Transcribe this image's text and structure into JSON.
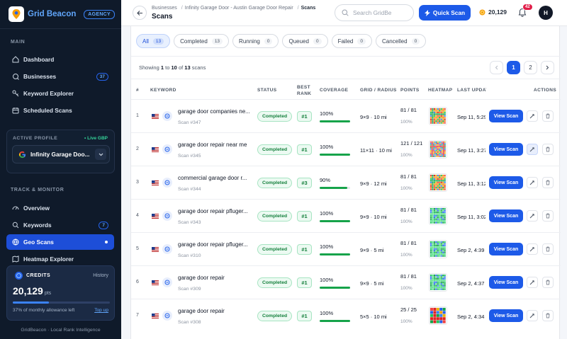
{
  "brand": {
    "name": "Grid Beacon",
    "badge": "AGENCY"
  },
  "sidebar": {
    "main_label": "MAIN",
    "main_items": [
      {
        "label": "Dashboard",
        "icon": "dashboard-icon"
      },
      {
        "label": "Businesses",
        "icon": "building-icon",
        "count": "37"
      },
      {
        "label": "Keyword Explorer",
        "icon": "key-icon"
      },
      {
        "label": "Scheduled Scans",
        "icon": "calendar-icon"
      }
    ],
    "profile": {
      "label": "ACTIVE PROFILE",
      "live": "• Live GBP",
      "name": "Infinity Garage Doo..."
    },
    "track_label": "TRACK & MONITOR",
    "track_items": [
      {
        "label": "Overview",
        "icon": "gauge-icon"
      },
      {
        "label": "Keywords",
        "icon": "search-icon",
        "count": "7"
      },
      {
        "label": "Geo Scans",
        "icon": "globe-icon",
        "active": true
      },
      {
        "label": "Heatmap Explorer",
        "icon": "map-icon"
      }
    ],
    "credits": {
      "title": "CREDITS",
      "history": "History",
      "amount": "20,129",
      "unit": "pts",
      "allowance": "37% of monthly allowance left",
      "topup": "Top up",
      "fraction": 0.37
    },
    "footer": "GridBeacon · Local Rank Intelligence"
  },
  "topbar": {
    "breadcrumbs": [
      "Businesses",
      "Infinity Garage Door - Austin Garage Door Repair",
      "Scans"
    ],
    "title": "Scans",
    "search_placeholder": "Search GridBe",
    "quick_scan": "Quick Scan",
    "credits": "20,129",
    "notifications": "42",
    "avatar": "H"
  },
  "filters": [
    {
      "label": "All",
      "count": "13",
      "active": true
    },
    {
      "label": "Completed",
      "count": "13"
    },
    {
      "label": "Running",
      "count": "0"
    },
    {
      "label": "Queued",
      "count": "0"
    },
    {
      "label": "Failed",
      "count": "0"
    },
    {
      "label": "Cancelled",
      "count": "0"
    }
  ],
  "showing": {
    "prefix": "Showing",
    "from": "1",
    "to_word": "to",
    "to": "10",
    "of_word": "of",
    "total": "13",
    "suffix": "scans"
  },
  "pagination": {
    "pages": [
      "1",
      "2"
    ]
  },
  "columns": {
    "num": "#",
    "keyword": "KEYWORD",
    "status": "STATUS",
    "best_rank": "BEST\nRANK",
    "coverage": "COVERAGE",
    "grid": "GRID / RADIUS",
    "points": "POINTS",
    "heatmap": "HEATMAP",
    "last_updated": "LAST UPDATED",
    "actions": "ACTIONS"
  },
  "rows": [
    {
      "n": "1",
      "keyword": "garage door companies ne...",
      "scan": "Scan #347",
      "status": "Completed",
      "rank": "#1",
      "coverage": "100%",
      "cov": 1.0,
      "grid": "9×9 · 10 mi",
      "points": "81 / 81",
      "pct": "100%",
      "date": "Sep 11, 5:29",
      "heat": "r",
      "view": "View Scan"
    },
    {
      "n": "2",
      "keyword": "garage door repair near me",
      "scan": "Scan #345",
      "status": "Completed",
      "rank": "#1",
      "coverage": "100%",
      "cov": 1.0,
      "grid": "11×11 · 10 mi",
      "points": "121 / 121",
      "pct": "100%",
      "date": "Sep 11, 3:27",
      "heat": "m",
      "view": "View Scan"
    },
    {
      "n": "3",
      "keyword": "commercial garage door r...",
      "scan": "Scan #344",
      "status": "Completed",
      "rank": "#3",
      "coverage": "90%",
      "cov": 0.9,
      "grid": "9×9 · 12 mi",
      "points": "81 / 81",
      "pct": "100%",
      "date": "Sep 11, 3:12",
      "heat": "r",
      "view": "View Scan"
    },
    {
      "n": "4",
      "keyword": "garage door repair pfluger...",
      "scan": "Scan #343",
      "status": "Completed",
      "rank": "#1",
      "coverage": "100%",
      "cov": 1.0,
      "grid": "9×9 · 10 mi",
      "points": "81 / 81",
      "pct": "100%",
      "date": "Sep 11, 3:02",
      "heat": "g",
      "view": "View Scan"
    },
    {
      "n": "5",
      "keyword": "garage door repair pfluger...",
      "scan": "Scan #310",
      "status": "Completed",
      "rank": "#1",
      "coverage": "100%",
      "cov": 1.0,
      "grid": "9×9 · 5 mi",
      "points": "81 / 81",
      "pct": "100%",
      "date": "Sep 2, 4:39",
      "heat": "g",
      "view": "View Scan"
    },
    {
      "n": "6",
      "keyword": "garage door repair",
      "scan": "Scan #309",
      "status": "Completed",
      "rank": "#1",
      "coverage": "100%",
      "cov": 1.0,
      "grid": "9×9 · 5 mi",
      "points": "81 / 81",
      "pct": "100%",
      "date": "Sep 2, 4:37",
      "heat": "g",
      "view": "View Scan"
    },
    {
      "n": "7",
      "keyword": "garage door repair",
      "scan": "Scan #308",
      "status": "Completed",
      "rank": "#1",
      "coverage": "100%",
      "cov": 1.0,
      "grid": "5×5 · 10 mi",
      "points": "25 / 25",
      "pct": "100%",
      "date": "Sep 2, 4:34",
      "heat": "m",
      "view": "View Scan"
    }
  ]
}
